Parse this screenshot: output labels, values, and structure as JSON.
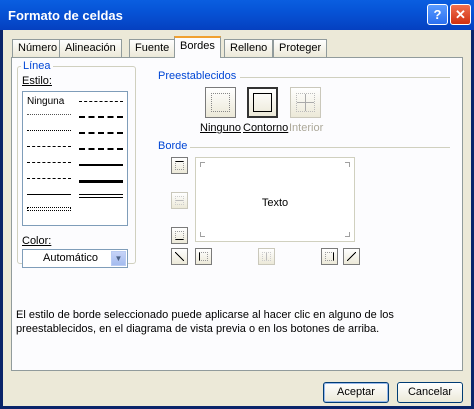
{
  "window": {
    "title": "Formato de celdas",
    "help_glyph": "?",
    "close_glyph": "✕"
  },
  "tabs": [
    {
      "label": "Número"
    },
    {
      "label": "Alineación"
    },
    {
      "label": "Fuente"
    },
    {
      "label": "Bordes",
      "active": true
    },
    {
      "label": "Relleno"
    },
    {
      "label": "Proteger"
    }
  ],
  "linea": {
    "title": "Línea",
    "estilo_label": "Estilo:",
    "none_label": "Ninguna",
    "color_label": "Color:",
    "color_value": "Automático"
  },
  "preestablecidos": {
    "title": "Preestablecidos",
    "ninguno": "Ninguno",
    "contorno": "Contorno",
    "interior": "Interior"
  },
  "borde": {
    "title": "Borde",
    "preview_text": "Texto"
  },
  "description": "El estilo de borde seleccionado puede aplicarse al hacer clic en alguno de los preestablecidos, en el diagrama de vista previa o en los botones de arriba.",
  "buttons": {
    "ok": "Aceptar",
    "cancel": "Cancelar"
  },
  "colors": {
    "titlebar": "#0653d6",
    "dialog_bg": "#ece9d8",
    "accent_text": "#0046d5"
  }
}
